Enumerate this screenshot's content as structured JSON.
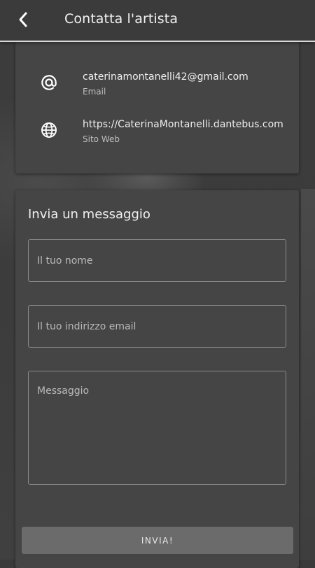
{
  "header": {
    "title": "Contatta l'artista",
    "back_icon": "chevron-left-icon"
  },
  "contacts": [
    {
      "icon": "at-sign-icon",
      "value": "caterinamontanelli42@gmail.com",
      "caption": "Email"
    },
    {
      "icon": "globe-icon",
      "value": "https://CaterinaMontanelli.dantebus.com",
      "caption": "Sito Web"
    }
  ],
  "form": {
    "title": "Invia un messaggio",
    "name_placeholder": "Il tuo nome",
    "email_placeholder": "Il tuo indirizzo email",
    "message_placeholder": "Messaggio",
    "submit_label": "INVIA!"
  },
  "colors": {
    "background": "#3a3a3a",
    "card": "#454545",
    "header_underline": "#d9d9d9",
    "button": "#6b6b6b"
  }
}
